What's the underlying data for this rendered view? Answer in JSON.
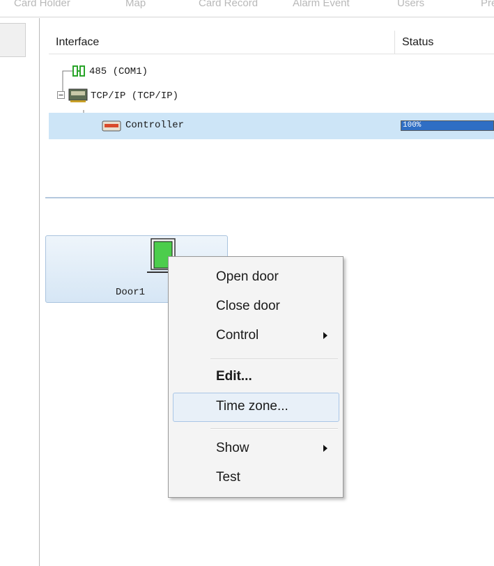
{
  "tabs": [
    "Card Holder",
    "Map",
    "Card Record",
    "Alarm Event",
    "Users",
    "Pre"
  ],
  "columns": {
    "interface": "Interface",
    "status": "Status"
  },
  "tree": [
    {
      "label": "485 (COM1)",
      "icon": "serial-port-icon"
    },
    {
      "label": "TCP/IP (TCP/IP)",
      "icon": "network-card-icon"
    },
    {
      "label": "Controller",
      "icon": "controller-icon",
      "selected": true,
      "progress": 100,
      "progress_label": "100%"
    }
  ],
  "door": {
    "label": "Door1",
    "icon": "door-icon"
  },
  "context_menu": {
    "items": [
      {
        "label": "Open door"
      },
      {
        "label": "Close door"
      },
      {
        "label": "Control",
        "submenu": true
      },
      {
        "label": "Edit...",
        "bold": true
      },
      {
        "label": "Time zone...",
        "hovered": true
      },
      {
        "label": "Show",
        "submenu": true
      },
      {
        "label": "Test"
      }
    ]
  },
  "colors": {
    "selection": "#cde5f7",
    "progress": "#2f6ec4",
    "door_green": "#4ccd4c",
    "menu_hover": "#e8f0f8"
  }
}
